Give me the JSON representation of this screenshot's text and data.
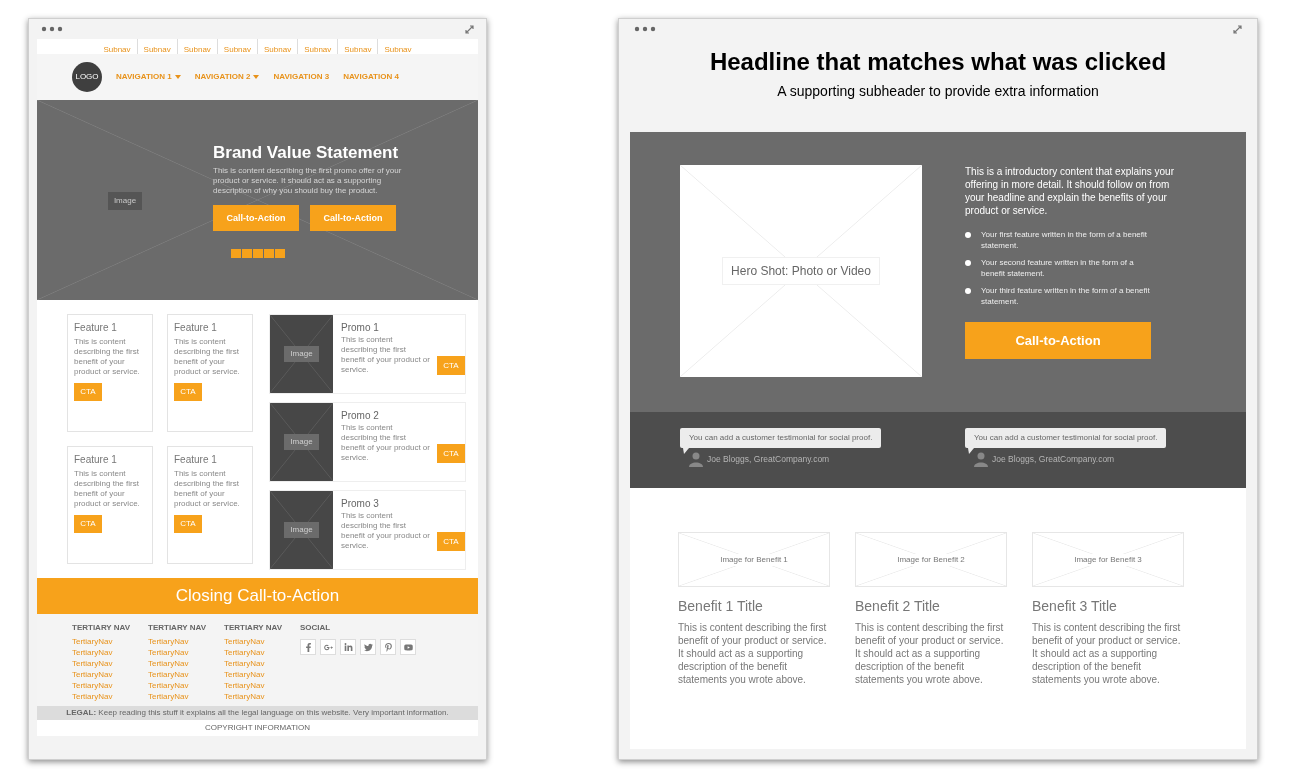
{
  "homepage_wireframe": {
    "subnav": [
      "Subnav",
      "Subnav",
      "Subnav",
      "Subnav",
      "Subnav",
      "Subnav",
      "Subnav",
      "Subnav"
    ],
    "logo": "LOGO",
    "navigation": [
      {
        "label": "NAVIGATION 1",
        "dropdown": true
      },
      {
        "label": "NAVIGATION 2",
        "dropdown": true
      },
      {
        "label": "NAVIGATION 3",
        "dropdown": false
      },
      {
        "label": "NAVIGATION 4",
        "dropdown": false
      }
    ],
    "hero": {
      "image_label": "Image",
      "title": "Brand Value Statement",
      "text": "This is content describing the first promo offer of your product or service. It should act as a supporting description of why you should buy the product.",
      "buttons": [
        "Call-to-Action",
        "Call-to-Action"
      ]
    },
    "features": [
      {
        "title": "Feature 1",
        "text": "This is content describing the first benefit of your product or service.",
        "cta": "CTA"
      },
      {
        "title": "Feature 1",
        "text": "This is content describing the first benefit of your product or service.",
        "cta": "CTA"
      },
      {
        "title": "Feature 1",
        "text": "This is content describing the first benefit of your product or service.",
        "cta": "CTA"
      },
      {
        "title": "Feature 1",
        "text": "This is content describing the first benefit of your product or service.",
        "cta": "CTA"
      }
    ],
    "promos": [
      {
        "image_label": "Image",
        "title": "Promo 1",
        "text": "This is content describing the first benefit of your product or service.",
        "cta": "CTA"
      },
      {
        "image_label": "Image",
        "title": "Promo 2",
        "text": "This is content describing the first benefit of your product or service.",
        "cta": "CTA"
      },
      {
        "image_label": "Image",
        "title": "Promo 3",
        "text": "This is content describing the first benefit of your product or service.",
        "cta": "CTA"
      }
    ],
    "closing_cta": "Closing Call-to-Action",
    "footer": {
      "columns": [
        {
          "heading": "TERTIARY NAV",
          "links": [
            "TertiaryNav",
            "TertiaryNav",
            "TertiaryNav",
            "TertiaryNav",
            "TertiaryNav",
            "TertiaryNav"
          ]
        },
        {
          "heading": "TERTIARY NAV",
          "links": [
            "TertiaryNav",
            "TertiaryNav",
            "TertiaryNav",
            "TertiaryNav",
            "TertiaryNav",
            "TertiaryNav"
          ]
        },
        {
          "heading": "TERTIARY NAV",
          "links": [
            "TertiaryNav",
            "TertiaryNav",
            "TertiaryNav",
            "TertiaryNav",
            "TertiaryNav",
            "TertiaryNav"
          ]
        }
      ],
      "social_heading": "SOCIAL"
    },
    "legal": "**LEGAL:** Keep reading this stuff it explains all the legal language on this website. Very important information.",
    "copyright": "COPYRIGHT INFORMATION"
  },
  "landing_page_wireframe": {
    "headline": "Headline that matches what was clicked",
    "subheader": "A supporting subheader to provide extra information",
    "hero_image_label": "Hero Shot: Photo or Video",
    "intro": "This is a introductory content that explains your offering in more detail. It should follow on from your headline and explain the benefits of your product or service.",
    "features": [
      "Your first feature written in the form of a benefit statement.",
      "Your second feature written in the form of a benefit statement.",
      "Your third feature written in the form of a benefit statement."
    ],
    "cta": "Call-to-Action",
    "testimonials": [
      {
        "quote": "You can add a customer testimonial for social proof.",
        "author": "Joe Bloggs, GreatCompany.com"
      },
      {
        "quote": "You can add a customer testimonial for social proof.",
        "author": "Joe Bloggs, GreatCompany.com"
      }
    ],
    "benefits": [
      {
        "image_label": "Image for Benefit 1",
        "title": "Benefit 1 Title",
        "text": "This is content describing the first benefit of your product or service. It should act as a supporting description of the benefit statements you wrote above."
      },
      {
        "image_label": "Image for Benefit 2",
        "title": "Benefit 2 Title",
        "text": "This is content describing the first benefit of your product or service. It should act as a supporting description of the benefit statements you wrote above."
      },
      {
        "image_label": "Image for Benefit 3",
        "title": "Benefit 3 Title",
        "text": "This is content describing the first benefit of your product or service. It should act as a supporting description of the benefit statements you wrote above."
      }
    ]
  }
}
